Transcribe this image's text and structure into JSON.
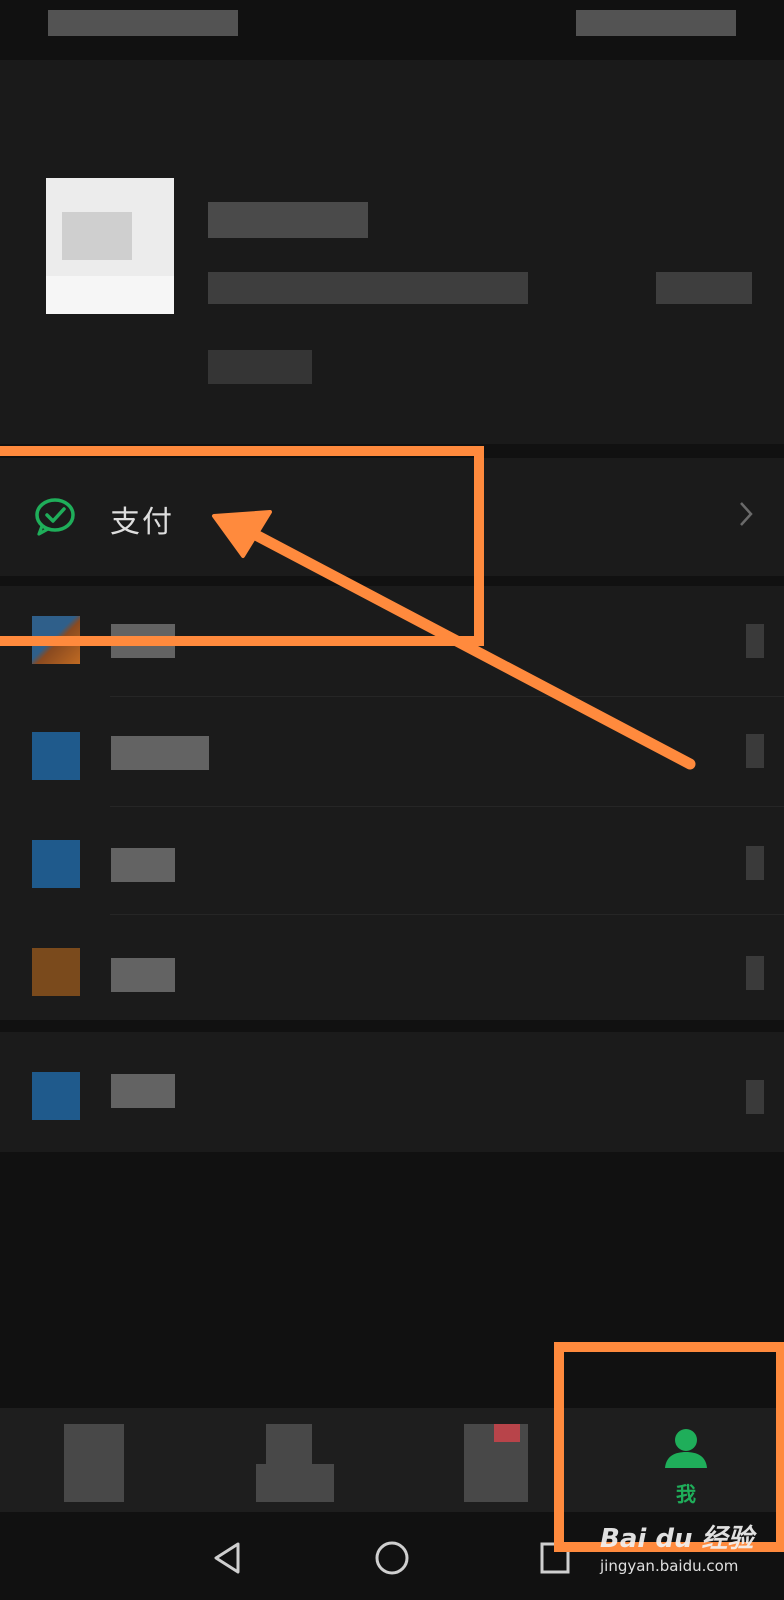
{
  "pay_row": {
    "label": "支付"
  },
  "tabbar": {
    "me_label": "我"
  },
  "colors": {
    "accent_green": "#1fae5a",
    "annotation_orange": "#ff8a3d",
    "background": "#111111",
    "row_background": "#1b1b1b"
  },
  "watermark": {
    "brand": "Bai du 经验",
    "url": "jingyan.baidu.com"
  }
}
